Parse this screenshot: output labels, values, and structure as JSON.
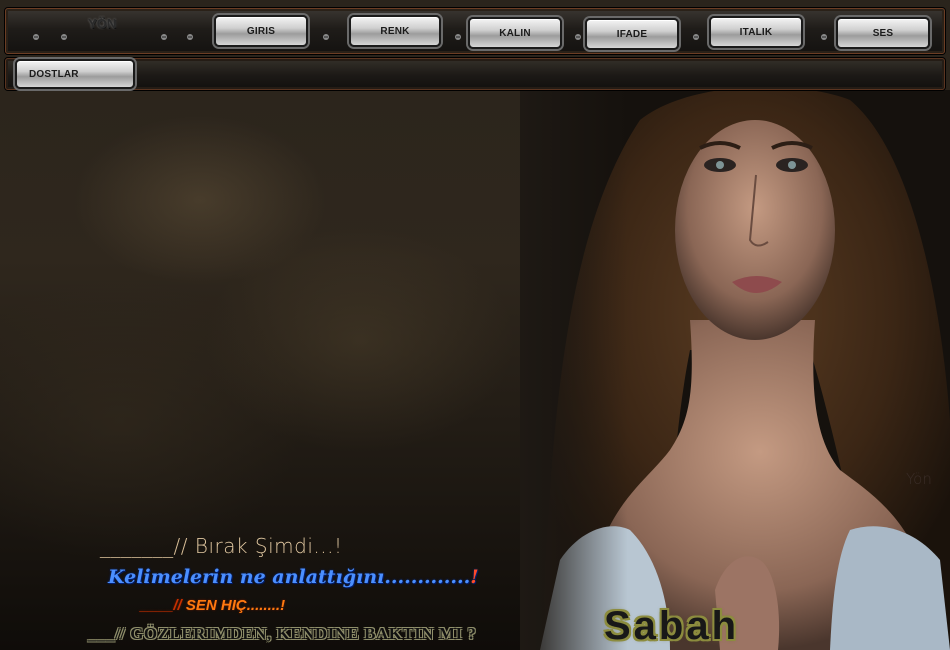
{
  "menu": {
    "brand": "YÖN",
    "items": [
      {
        "label": "GIRIS"
      },
      {
        "label": "RENK"
      },
      {
        "label": "KALIN"
      },
      {
        "label": "IFADE"
      },
      {
        "label": "ITALIK"
      },
      {
        "label": "SES"
      }
    ],
    "second_row": [
      {
        "label": "DOSTLAR"
      }
    ]
  },
  "poem": {
    "line1_dash": "_______//",
    "line1_text": " Bırak Şimdi...!",
    "line2_text": "Kelimelerin ne anlattığını.............",
    "line2_bang": "!",
    "line3_dash": "____//",
    "line3_text": " SEN HIÇ........!",
    "line4_text": "___// GÖZLERIMDEN, KENDINE BAKTIN MI ?"
  },
  "signature": "Sabah",
  "watermark": "Yön",
  "colors": {
    "frame_accent": "#6b3d24",
    "line2_color": "#4b8fff",
    "line3_color": "#ff7a10",
    "signature_color": "#8c8c3e"
  }
}
